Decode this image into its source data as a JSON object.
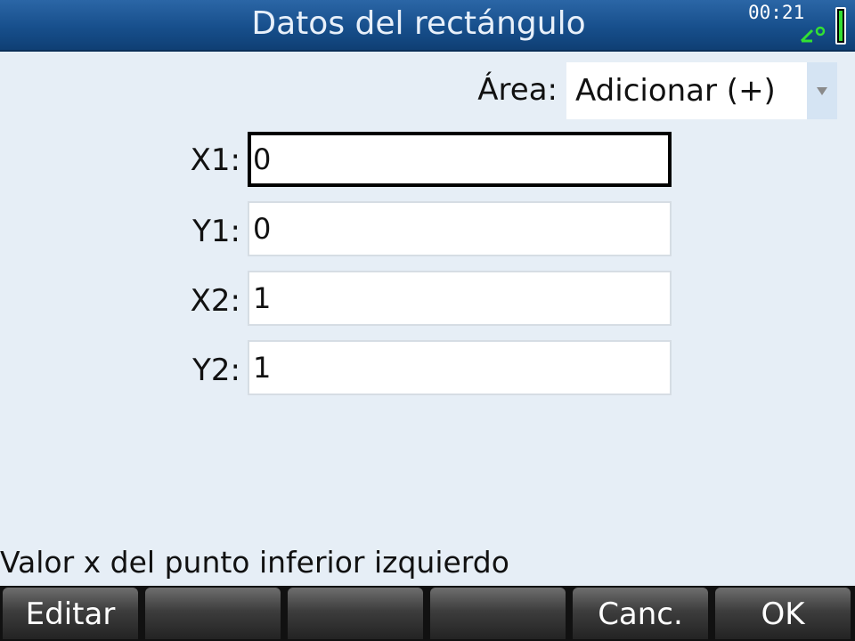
{
  "title_bar": {
    "title": "Datos del rectángulo",
    "clock": "00:21",
    "angle_icon": "angle-degree-icon",
    "battery_icon": "battery-icon",
    "battery_color": "#33e033"
  },
  "form": {
    "area": {
      "label": "Área:",
      "value": "Adicionar (+)"
    },
    "fields": [
      {
        "label": "X1:",
        "value": "0"
      },
      {
        "label": "Y1:",
        "value": "0"
      },
      {
        "label": "X2:",
        "value": "1"
      },
      {
        "label": "Y2:",
        "value": "1"
      }
    ]
  },
  "help_text": "Valor x del punto inferior izquierdo",
  "softkeys": [
    "Editar",
    "",
    "",
    "",
    "Canc.",
    "OK"
  ],
  "colors": {
    "title_bar": "#174f8c",
    "background": "#e6eef6",
    "softkey_bar": "#111111"
  }
}
